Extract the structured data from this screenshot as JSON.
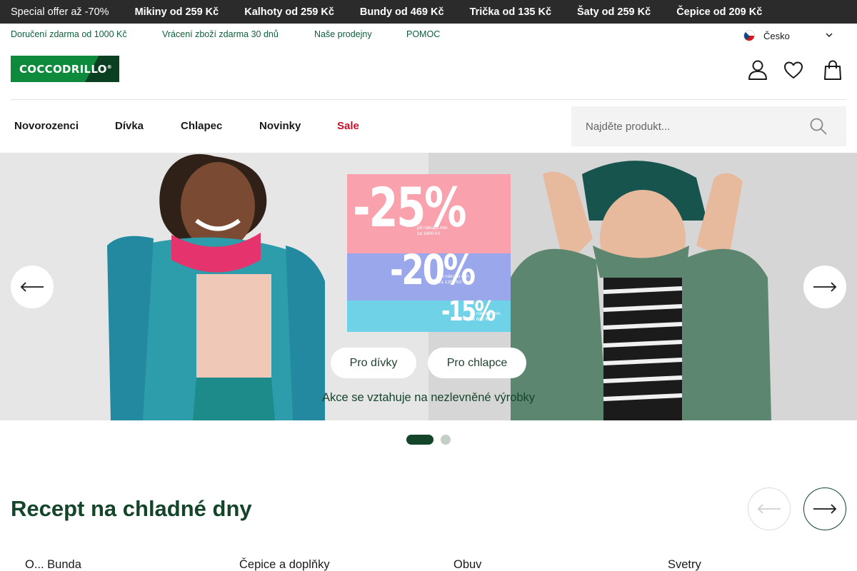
{
  "promo_strip": {
    "first": "Special offer až -70%",
    "items": [
      "Mikiny od 259 Kč",
      "Kalhoty od 259 Kč",
      "Bundy od 469 Kč",
      "Trička od 135 Kč",
      "Šaty od 259 Kč",
      "Čepice od 209 Kč"
    ]
  },
  "info_bar": {
    "links": [
      "Doručení zdarma od 1000 Kč",
      "Vrácení zboží zdarma 30 dnů",
      "Naše prodejny",
      "POMOC"
    ],
    "language": "Česko"
  },
  "header": {
    "logo_text": "COCCODRILLO",
    "logo_mark": "®",
    "icons": [
      "user-icon",
      "heart-icon",
      "bag-icon"
    ]
  },
  "nav": {
    "items": [
      "Novorozenci",
      "Dívka",
      "Chlapec",
      "Novinky",
      "Sale"
    ],
    "search_placeholder": "Najděte produkt..."
  },
  "hero": {
    "promo": {
      "tier1_big": "-25%",
      "tier1_small": "při nákupu min. za 1800 Kč",
      "tier2_big": "-20%",
      "tier2_small": "při nákupu min. za 1300 Kč",
      "tier3_big": "-15%",
      "tier3_small": "při nákupu min. za 600 Kč"
    },
    "buttons": [
      "Pro dívky",
      "Pro chlapce"
    ],
    "note": "Akce se vztahuje na nezlevněné výrobky",
    "slides_total": 2,
    "active_slide": 1
  },
  "section": {
    "title": "Recept na chladné dny",
    "categories": [
      "O... Bunda",
      "Čepice a doplňky",
      "Obuv",
      "Svetry"
    ]
  },
  "colors": {
    "brand_green": "#0e8a3c",
    "dark_green": "#14452b",
    "sale_red": "#c8102e",
    "promo_pink": "#f9a2ad",
    "promo_purple": "#9aa7ea",
    "promo_cyan": "#6fd2e6"
  }
}
